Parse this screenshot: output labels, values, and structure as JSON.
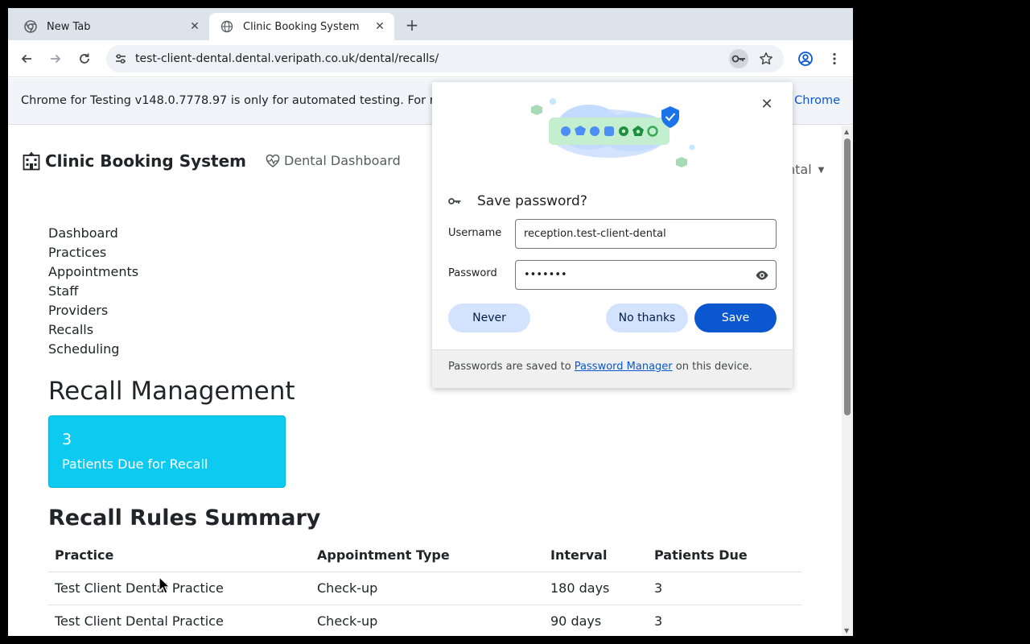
{
  "browser": {
    "tabs": [
      {
        "title": "New Tab",
        "icon": "chrome-icon"
      },
      {
        "title": "Clinic Booking System",
        "icon": "globe-icon"
      }
    ],
    "url": "test-client-dental.dental.veripath.co.uk/dental/recalls/",
    "infobar": {
      "message": "Chrome for Testing v148.0.7778.97 is only for automated testing. For re",
      "link": "d Chrome"
    }
  },
  "navbar": {
    "brand": "Clinic Booking System",
    "dashboard_link": "Dental Dashboard",
    "right_dropdown": "ntal"
  },
  "sidebar": {
    "items": [
      "Dashboard",
      "Practices",
      "Appointments",
      "Staff",
      "Providers",
      "Recalls",
      "Scheduling"
    ]
  },
  "main": {
    "heading": "Recall Management",
    "stat_card": {
      "count": "3",
      "label": "Patients Due for Recall",
      "color": "#0dcaf0"
    },
    "rules_heading": "Recall Rules Summary",
    "table": {
      "headers": [
        "Practice",
        "Appointment Type",
        "Interval",
        "Patients Due"
      ],
      "rows": [
        [
          "Test Client Dental Practice",
          "Check-up",
          "180 days",
          "3"
        ],
        [
          "Test Client Dental Practice",
          "Check-up",
          "90 days",
          "3"
        ]
      ]
    }
  },
  "password_bubble": {
    "title": "Save password?",
    "username_label": "Username",
    "username_value": "reception.test-client-dental",
    "password_label": "Password",
    "password_value": "•••••••",
    "never_label": "Never",
    "no_thanks_label": "No thanks",
    "save_label": "Save",
    "footer_prefix": "Passwords are saved to",
    "footer_link": "Password Manager",
    "footer_suffix": "on this device."
  }
}
